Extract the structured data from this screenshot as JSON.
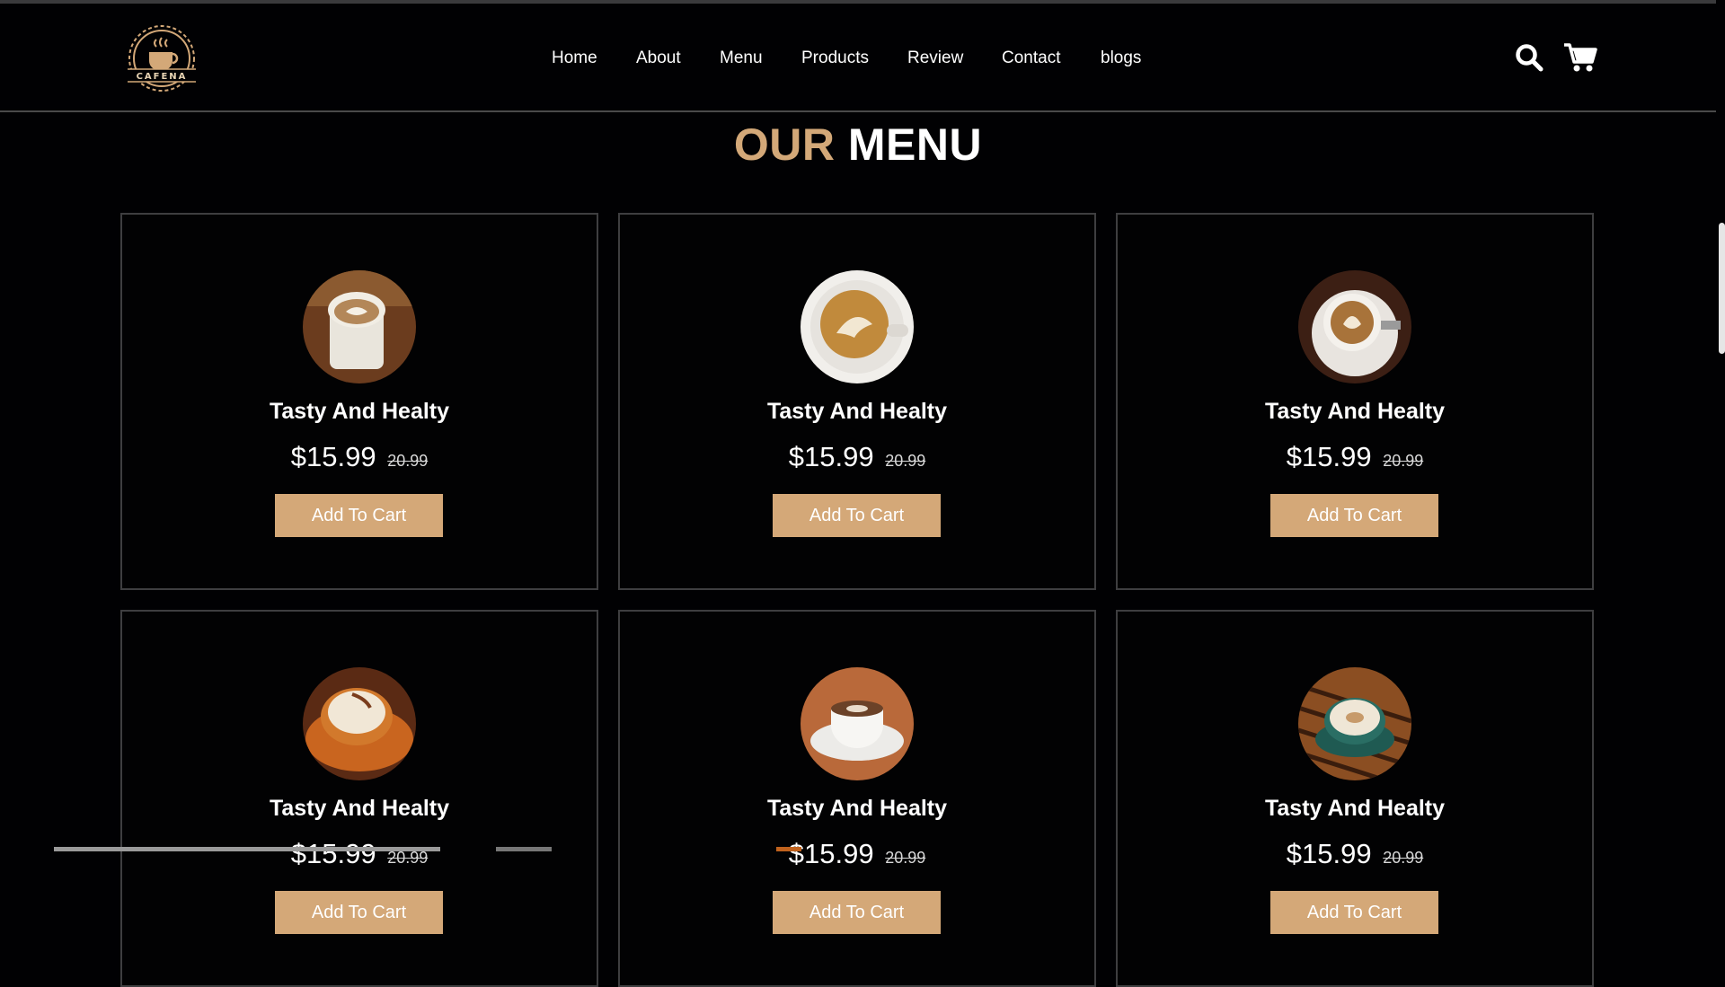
{
  "brand": {
    "logo_text": "CAFENA",
    "accent": "#d3a878"
  },
  "nav": {
    "items": [
      {
        "label": "Home"
      },
      {
        "label": "About"
      },
      {
        "label": "Menu"
      },
      {
        "label": "Products"
      },
      {
        "label": "Review"
      },
      {
        "label": "Contact"
      },
      {
        "label": "blogs"
      }
    ]
  },
  "header_icons": {
    "search": "search-icon",
    "cart": "cart-icon"
  },
  "section": {
    "title_accent": "OUR",
    "title_main": "MENU"
  },
  "menu": {
    "items": [
      {
        "title": "Tasty And Healty",
        "price": "$15.99",
        "old_price": "20.99",
        "button": "Add To Cart"
      },
      {
        "title": "Tasty And Healty",
        "price": "$15.99",
        "old_price": "20.99",
        "button": "Add To Cart"
      },
      {
        "title": "Tasty And Healty",
        "price": "$15.99",
        "old_price": "20.99",
        "button": "Add To Cart"
      },
      {
        "title": "Tasty And Healty",
        "price": "$15.99",
        "old_price": "20.99",
        "button": "Add To Cart"
      },
      {
        "title": "Tasty And Healty",
        "price": "$15.99",
        "old_price": "20.99",
        "button": "Add To Cart"
      },
      {
        "title": "Tasty And Healty",
        "price": "$15.99",
        "old_price": "20.99",
        "button": "Add To Cart"
      }
    ]
  },
  "colors": {
    "background": "#010103",
    "button": "#d4a878",
    "card_border": "#3e3e40"
  }
}
